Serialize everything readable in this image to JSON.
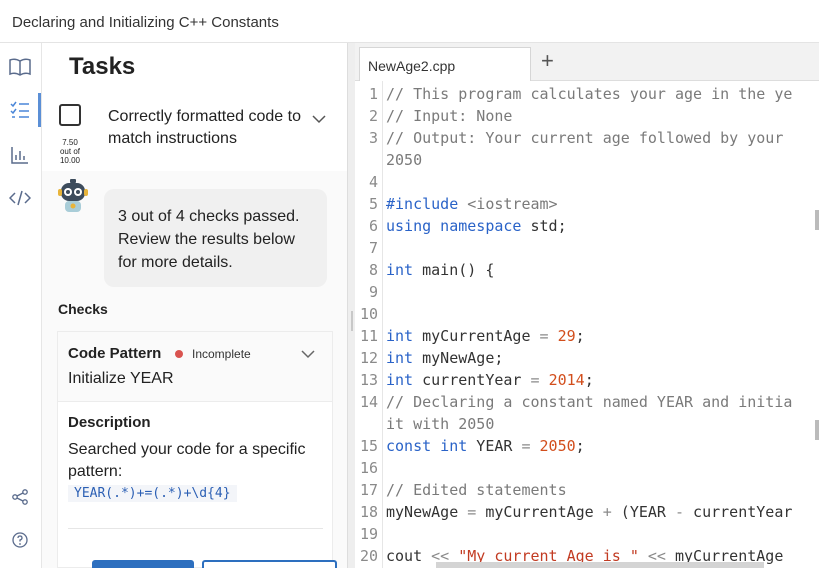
{
  "window": {
    "title": "Declaring and Initializing C++ Constants"
  },
  "rail": {
    "items": [
      {
        "icon": "book-icon"
      },
      {
        "icon": "tasks-list-icon",
        "active": true
      },
      {
        "icon": "bar-chart-icon"
      },
      {
        "icon": "code-icon"
      },
      {
        "icon": "share-icon"
      },
      {
        "icon": "help-icon"
      }
    ]
  },
  "panel": {
    "title": "Tasks",
    "task": {
      "label": "Correctly formatted code to match instructions",
      "score": "7.50",
      "score_of": "out of",
      "score_total": "10.00"
    },
    "feedback": "3 out of 4 checks passed. Review the results below for more details.",
    "checks_label": "Checks",
    "check": {
      "name": "Code Pattern",
      "status": "Incomplete",
      "status_color": "#d9534f",
      "title": "Initialize YEAR",
      "description_label": "Description",
      "description": "Searched your code for a specific pattern:",
      "pattern": "YEAR(.*)+=(.*)+\\d{4}"
    }
  },
  "editor": {
    "tab_name": "NewAge2.cpp",
    "add_tab": "+",
    "lines": [
      {
        "n": "1",
        "tokens": [
          {
            "t": "// This program calculates your age in the ye",
            "c": "c-com"
          }
        ]
      },
      {
        "n": "2",
        "tokens": [
          {
            "t": "// Input: None",
            "c": "c-com"
          }
        ]
      },
      {
        "n": "3",
        "tokens": [
          {
            "t": "// Output: Your current age followed by your",
            "c": "c-com"
          }
        ]
      },
      {
        "n": "",
        "tokens": [
          {
            "t": "2050",
            "c": "c-com"
          }
        ]
      },
      {
        "n": "4",
        "tokens": []
      },
      {
        "n": "5",
        "tokens": [
          {
            "t": "#include ",
            "c": "c-kw"
          },
          {
            "t": "<iostream>",
            "c": "c-com"
          }
        ]
      },
      {
        "n": "6",
        "tokens": [
          {
            "t": "using namespace",
            "c": "c-kw"
          },
          {
            "t": " std;",
            "c": "c-plain"
          }
        ]
      },
      {
        "n": "7",
        "tokens": []
      },
      {
        "n": "8",
        "tokens": [
          {
            "t": "int",
            "c": "c-kw"
          },
          {
            "t": " main() {",
            "c": "c-plain"
          }
        ]
      },
      {
        "n": "9",
        "tokens": []
      },
      {
        "n": "10",
        "tokens": []
      },
      {
        "n": "11",
        "tokens": [
          {
            "t": "int",
            "c": "c-kw"
          },
          {
            "t": " myCurrentAge ",
            "c": "c-plain"
          },
          {
            "t": "=",
            "c": "c-op"
          },
          {
            "t": " ",
            "c": "c-plain"
          },
          {
            "t": "29",
            "c": "c-num"
          },
          {
            "t": ";",
            "c": "c-plain"
          }
        ]
      },
      {
        "n": "12",
        "tokens": [
          {
            "t": "int",
            "c": "c-kw"
          },
          {
            "t": " myNewAge;",
            "c": "c-plain"
          }
        ]
      },
      {
        "n": "13",
        "tokens": [
          {
            "t": "int",
            "c": "c-kw"
          },
          {
            "t": " currentYear ",
            "c": "c-plain"
          },
          {
            "t": "=",
            "c": "c-op"
          },
          {
            "t": " ",
            "c": "c-plain"
          },
          {
            "t": "2014",
            "c": "c-num"
          },
          {
            "t": ";",
            "c": "c-plain"
          }
        ]
      },
      {
        "n": "14",
        "tokens": [
          {
            "t": "// Declaring a constant named YEAR and initia",
            "c": "c-com"
          }
        ]
      },
      {
        "n": "",
        "tokens": [
          {
            "t": "it with 2050",
            "c": "c-com"
          }
        ]
      },
      {
        "n": "15",
        "tokens": [
          {
            "t": "const int",
            "c": "c-kw"
          },
          {
            "t": " YEAR ",
            "c": "c-plain"
          },
          {
            "t": "=",
            "c": "c-op"
          },
          {
            "t": " ",
            "c": "c-plain"
          },
          {
            "t": "2050",
            "c": "c-num"
          },
          {
            "t": ";",
            "c": "c-plain"
          }
        ]
      },
      {
        "n": "16",
        "tokens": []
      },
      {
        "n": "17",
        "tokens": [
          {
            "t": "// Edited statements",
            "c": "c-com"
          }
        ]
      },
      {
        "n": "18",
        "tokens": [
          {
            "t": "myNewAge ",
            "c": "c-plain"
          },
          {
            "t": "=",
            "c": "c-op"
          },
          {
            "t": " myCurrentAge ",
            "c": "c-plain"
          },
          {
            "t": "+",
            "c": "c-op"
          },
          {
            "t": " (YEAR ",
            "c": "c-plain"
          },
          {
            "t": "-",
            "c": "c-op"
          },
          {
            "t": " currentYear",
            "c": "c-plain"
          }
        ]
      },
      {
        "n": "19",
        "tokens": []
      },
      {
        "n": "20",
        "tokens": [
          {
            "t": "cout ",
            "c": "c-plain"
          },
          {
            "t": "<<",
            "c": "c-op"
          },
          {
            "t": " \"My current Age is \" ",
            "c": "c-str"
          },
          {
            "t": "<<",
            "c": "c-op"
          },
          {
            "t": " myCurrentAge",
            "c": "c-plain"
          }
        ]
      }
    ]
  }
}
